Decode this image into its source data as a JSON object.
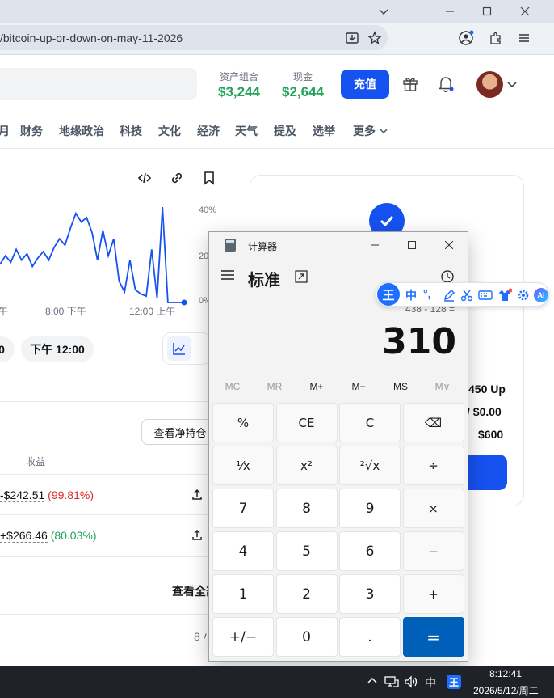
{
  "browser": {
    "url": "/bitcoin-up-or-down-on-may-11-2026"
  },
  "header": {
    "portfolio_label": "资产组合",
    "portfolio_value": "$3,244",
    "cash_label": "现金",
    "cash_value": "$2,644",
    "deposit_label": "充值"
  },
  "nav": {
    "items": [
      "月",
      "财务",
      "地缘政治",
      "科技",
      "文化",
      "经济",
      "天气",
      "提及",
      "选举",
      "更多"
    ]
  },
  "chart": {
    "y_ticks": [
      "40%",
      "20",
      "0%"
    ],
    "x_ticks": [
      "午",
      "8:00 下午",
      "12:00 上午"
    ],
    "time_pills": [
      "0",
      "下午 12:00"
    ]
  },
  "chart_data": {
    "type": "line",
    "title": "",
    "xlabel": "",
    "ylabel": "",
    "x": [
      "午",
      "8:00 下午",
      "12:00 上午"
    ],
    "ylim": [
      0,
      45
    ],
    "series": [
      {
        "values": [
          18,
          22,
          19,
          25,
          20,
          23,
          17,
          21,
          24,
          20,
          26,
          30,
          27,
          35,
          42,
          38,
          40,
          33,
          20,
          34,
          22,
          30,
          10,
          5,
          20,
          6,
          4,
          3,
          25,
          2,
          45,
          0,
          0,
          0,
          0
        ]
      }
    ],
    "grid": false
  },
  "positions": {
    "view_holdings_label": "查看净持仓",
    "pnl_header": "收益",
    "rows": [
      {
        "pnl": "-$242.51",
        "pct": "(99.81%)"
      },
      {
        "pnl": "+$266.46",
        "pct": "(80.03%)"
      }
    ],
    "view_all_label": "查看全部",
    "footer_value": "8 小"
  },
  "card": {
    "row1": "450 Up",
    "row2": "/ $0.00",
    "row3": "$600"
  },
  "calculator": {
    "title": "计算器",
    "mode": "标准",
    "expression": "438 - 128 =",
    "display": "310",
    "memory": [
      "MC",
      "MR",
      "M+",
      "M−",
      "MS",
      "M∨"
    ],
    "keys": [
      "%",
      "CE",
      "C",
      "⌫",
      "¹⁄x",
      "x²",
      "²√x",
      "÷",
      "7",
      "8",
      "9",
      "×",
      "4",
      "5",
      "6",
      "−",
      "1",
      "2",
      "3",
      "+",
      "+/−",
      "0",
      ".",
      "="
    ]
  },
  "ime": {
    "logo": "王",
    "mode": "中",
    "punct": "°,"
  },
  "taskbar": {
    "ime_label": "中",
    "ime_logo": "王",
    "time": "8:12:41",
    "date": "2026/5/12/周二"
  }
}
